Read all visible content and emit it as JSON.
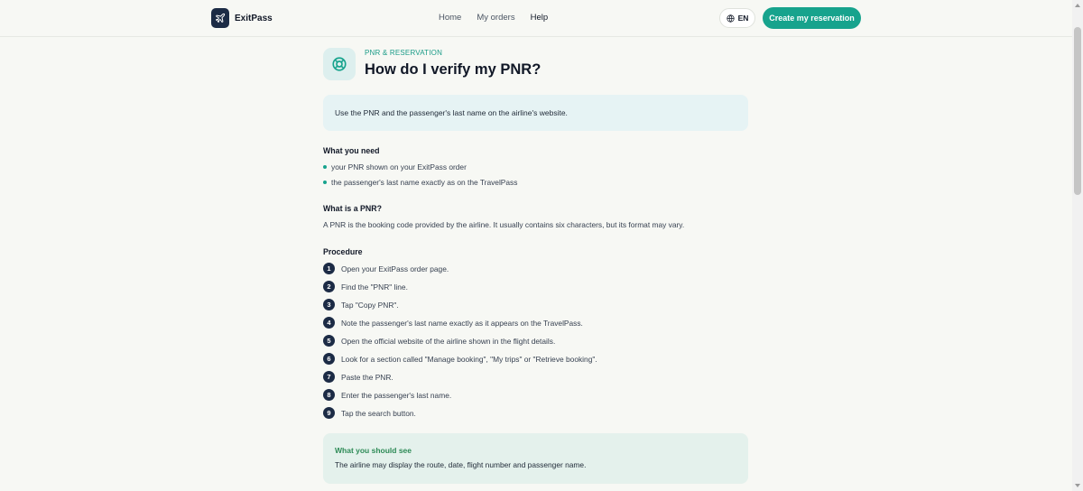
{
  "header": {
    "brand": "ExitPass",
    "nav": [
      "Home",
      "My orders",
      "Help"
    ],
    "language": "EN",
    "cta": "Create my reservation"
  },
  "article": {
    "category": "PNR & RESERVATION",
    "title": "How do I verify my PNR?",
    "summary": "Use the PNR and the passenger's last name on the airline's website.",
    "need_title": "What you need",
    "need_items": [
      "your PNR shown on your ExitPass order",
      "the passenger's last name exactly as on the TravelPass"
    ],
    "what_title": "What is a PNR?",
    "what_text": "A PNR is the booking code provided by the airline. It usually contains six characters, but its format may vary.",
    "procedure_title": "Procedure",
    "steps": [
      {
        "num": "1",
        "text": "Open your ExitPass order page."
      },
      {
        "num": "2",
        "text": "Find the \"PNR\" line."
      },
      {
        "num": "3",
        "text": "Tap \"Copy PNR\"."
      },
      {
        "num": "4",
        "text": "Note the passenger's last name exactly as it appears on the TravelPass."
      },
      {
        "num": "5",
        "text": "Open the official website of the airline shown in the flight details."
      },
      {
        "num": "6",
        "text": "Look for a section called \"Manage booking\", \"My trips\" or \"Retrieve booking\"."
      },
      {
        "num": "7",
        "text": "Paste the PNR."
      },
      {
        "num": "8",
        "text": "Enter the passenger's last name."
      },
      {
        "num": "9",
        "text": "Tap the search button."
      }
    ],
    "result_title": "What you should see",
    "result_text": "The airline may display the route, date, flight number and passenger name."
  },
  "colors": {
    "accent": "#17a38d",
    "navy": "#1c2b45",
    "summary_bg": "#e6f3f4",
    "result_bg": "#e4f1ec"
  },
  "icons": [
    "plane-icon",
    "globe-icon",
    "lifebuoy-icon"
  ]
}
